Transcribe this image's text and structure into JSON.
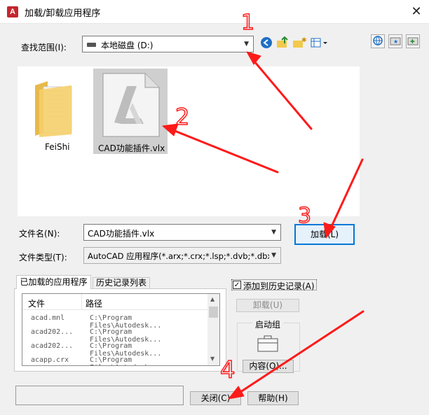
{
  "window": {
    "title": "加载/卸载应用程序",
    "close_glyph": "✕",
    "app_icon_letter": "A"
  },
  "lookin": {
    "label": "查找范围(I):",
    "value": "本地磁盘 (D:)"
  },
  "files": [
    {
      "name": "FeiShi",
      "icon": "folder-icon"
    },
    {
      "name": "CAD功能插件.vlx",
      "icon": "autocad-file-icon"
    }
  ],
  "filename": {
    "label": "文件名(N):",
    "value": "CAD功能插件.vlx"
  },
  "filetype": {
    "label": "文件类型(T):",
    "value": "AutoCAD 应用程序(*.arx;*.crx;*.lsp;*.dvb;*.dbx"
  },
  "load_button": "加载(L)",
  "tabs": {
    "loaded": "已加载的应用程序",
    "history": "历史记录列表"
  },
  "list": {
    "headers": {
      "file": "文件",
      "path": "路径"
    },
    "rows": [
      {
        "file": "acad.mnl",
        "path": "C:\\Program Files\\Autodesk..."
      },
      {
        "file": "acad202...",
        "path": "C:\\Program Files\\Autodesk..."
      },
      {
        "file": "acad202...",
        "path": "C:\\Program Files\\Autodesk..."
      },
      {
        "file": "acapp.crx",
        "path": "C:\\Program Files\\Autodesk..."
      }
    ]
  },
  "add_to_history": "添加到历史记录(A)",
  "unload_button": "卸载(U)",
  "startup_suite": {
    "label": "启动组",
    "contents_button": "内容(O)..."
  },
  "close_button": "关闭(C)",
  "help_button": "帮助(H)",
  "annotations": {
    "one": "1",
    "two": "2",
    "three": "3",
    "four": "4"
  },
  "colors": {
    "accent": "#0078d7",
    "annotation": "#ff1a1a",
    "autocad_red": "#c4262e"
  }
}
